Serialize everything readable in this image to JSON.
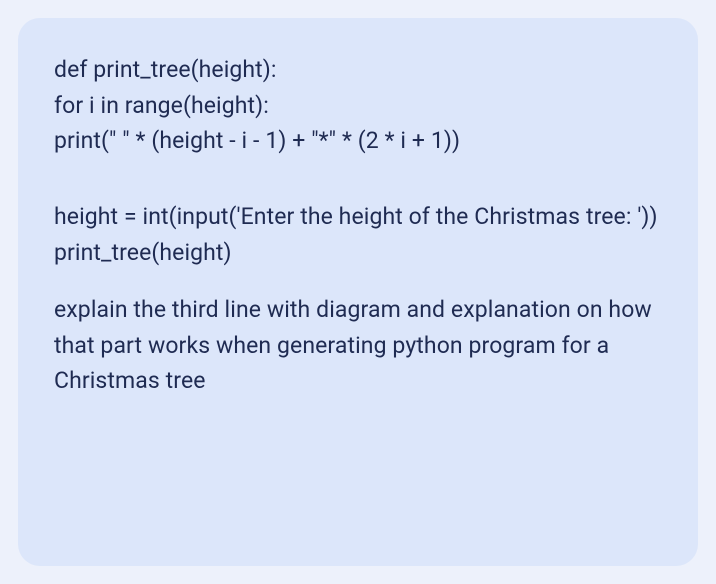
{
  "code": {
    "l1": "def print_tree(height):",
    "l2": "for i in range(height):",
    "l3": "print(\" \" * (height - i - 1) + \"*\" * (2 * i + 1))",
    "l4": "height = int(input('Enter the height of the Christmas tree: '))",
    "l5": "print_tree(height)"
  },
  "question": "explain the third line with diagram and explanation on how that part works when generating python program for a Christmas tree"
}
